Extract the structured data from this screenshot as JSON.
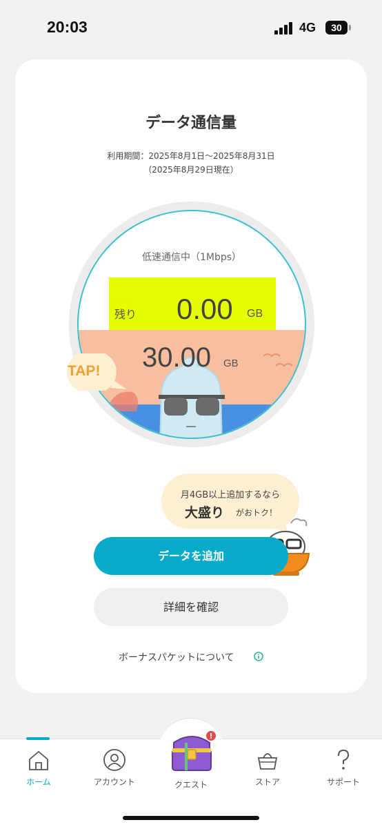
{
  "status_bar": {
    "time": "20:03",
    "network": "4G",
    "battery": "30"
  },
  "card": {
    "title": "データ通信量",
    "period": "利用期間：2025年8月1日〜2025年8月31日",
    "as_of": "（2025年8月29日現在）",
    "speed_status": "低速通信中（1Mbps）",
    "remaining_label": "残り",
    "remaining_value": "0.00",
    "remaining_unit": "GB",
    "total_value": "30.00",
    "total_unit": "GB",
    "tap_label": "TAP!",
    "promo_line1": "月4GB以上追加するなら",
    "promo_big": "大盛り",
    "promo_small": "がおトク！",
    "add_data_button": "データを追加",
    "details_button": "詳細を確認",
    "bonus_link": "ボーナスパケットについて"
  },
  "colors": {
    "accent": "#07aac8",
    "remaining_highlight": "#e6ff00",
    "sand": "#f7bea0",
    "sea": "#4a90e2",
    "tap": "#f0a030"
  },
  "tab_bar": {
    "items": [
      {
        "label": "ホーム",
        "icon": "home-icon",
        "active": true
      },
      {
        "label": "アカウント",
        "icon": "account-icon",
        "active": false
      },
      {
        "label": "クエスト",
        "icon": "treasure-chest-icon",
        "active": false
      },
      {
        "label": "ストア",
        "icon": "basket-icon",
        "active": false
      },
      {
        "label": "サポート",
        "icon": "question-icon",
        "active": false
      }
    ]
  }
}
